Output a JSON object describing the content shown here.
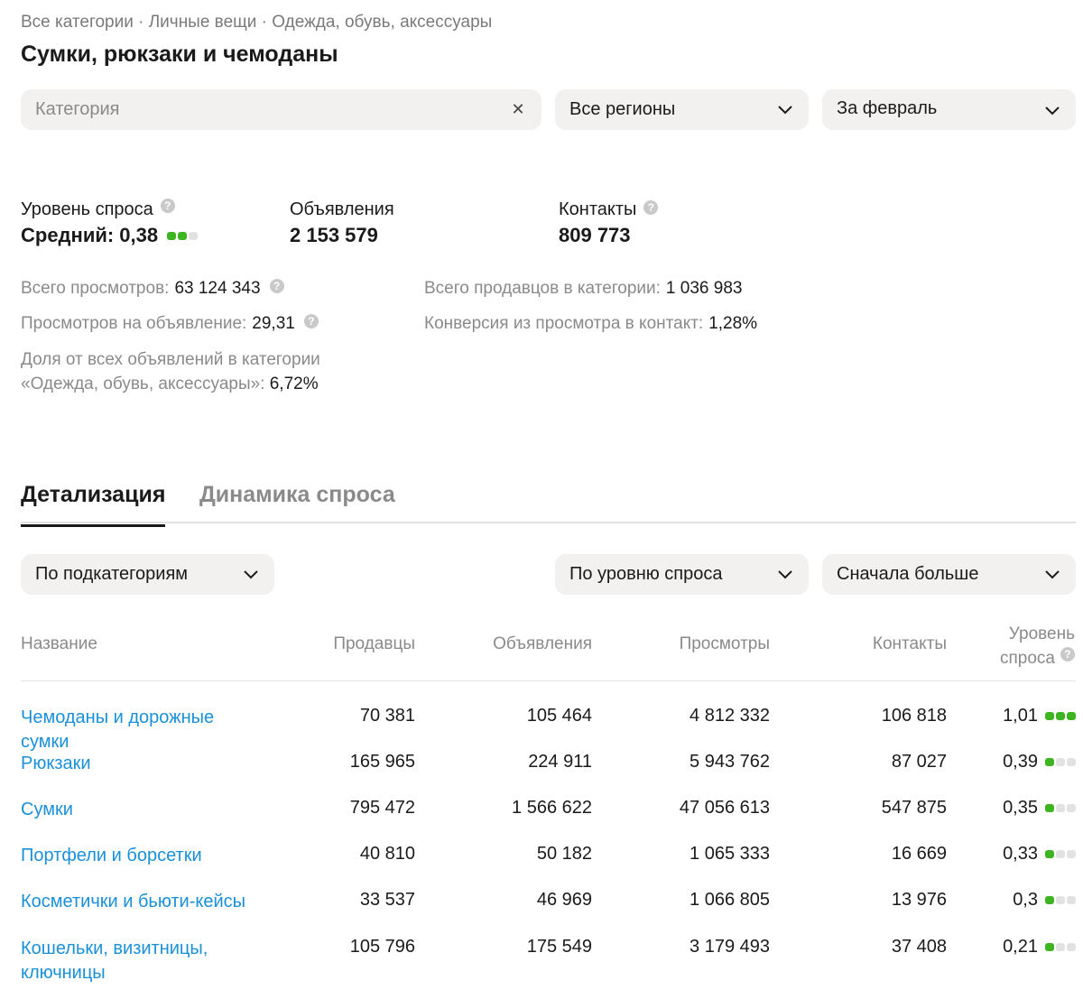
{
  "breadcrumb": "Все категории · Личные вещи · Одежда, обувь, аксессуары",
  "page_title": "Сумки, рюкзаки и чемоданы",
  "filters": {
    "category_placeholder": "Категория",
    "region": "Все регионы",
    "period": "За февраль"
  },
  "summary": {
    "demand_label": "Уровень спроса",
    "demand_value": "Средний: 0,38",
    "demand_level": 2,
    "ads_label": "Объявления",
    "ads_value": "2 153 579",
    "contacts_label": "Контакты",
    "contacts_value": "809 773"
  },
  "stats": {
    "views_label": "Всего просмотров:",
    "views_value": "63 124 343",
    "views_per_ad_label": "Просмотров на объявление:",
    "views_per_ad_value": "29,31",
    "share_label_line1": "Доля от всех объявлений в категории",
    "share_label_line2": "«Одежда, обувь, аксессуары»:",
    "share_value": "6,72%",
    "sellers_label": "Всего продавцов в категории:",
    "sellers_value": "1 036 983",
    "conversion_label": "Конверсия из просмотра в контакт:",
    "conversion_value": "1,28%"
  },
  "tabs": [
    "Детализация",
    "Динамика спроса"
  ],
  "table_controls": {
    "group_by": "По подкатегориям",
    "sort_by": "По уровню спроса",
    "order": "Сначала больше"
  },
  "table": {
    "headers": {
      "name": "Название",
      "sellers": "Продавцы",
      "ads": "Объявления",
      "views": "Просмотры",
      "contacts": "Контакты",
      "demand_line1": "Уровень",
      "demand_line2": "спроса"
    },
    "rows": [
      {
        "name": "Чемоданы и дорожные сумки",
        "sellers": "70 381",
        "ads": "105 464",
        "views": "4 812 332",
        "contacts": "106 818",
        "demand": "1,01",
        "level": 3
      },
      {
        "name": "Рюкзаки",
        "sellers": "165 965",
        "ads": "224 911",
        "views": "5 943 762",
        "contacts": "87 027",
        "demand": "0,39",
        "level": 1
      },
      {
        "name": "Сумки",
        "sellers": "795 472",
        "ads": "1 566 622",
        "views": "47 056 613",
        "contacts": "547 875",
        "demand": "0,35",
        "level": 1
      },
      {
        "name": "Портфели и борсетки",
        "sellers": "40 810",
        "ads": "50 182",
        "views": "1 065 333",
        "contacts": "16 669",
        "demand": "0,33",
        "level": 1
      },
      {
        "name": "Косметички и бьюти-кейсы",
        "sellers": "33 537",
        "ads": "46 969",
        "views": "1 066 805",
        "contacts": "13 976",
        "demand": "0,3",
        "level": 1
      },
      {
        "name": "Кошельки, визитницы, ключницы",
        "sellers": "105 796",
        "ads": "175 549",
        "views": "3 179 493",
        "contacts": "37 408",
        "demand": "0,21",
        "level": 1
      }
    ]
  },
  "colors": {
    "link": "#1a90d9",
    "demand_dot_on": "#3cb521",
    "demand_dot_off": "#e2e2e2",
    "field_bg": "#f2f1f0"
  },
  "icons": [
    "close-icon",
    "chevron-down-icon",
    "help-icon"
  ]
}
